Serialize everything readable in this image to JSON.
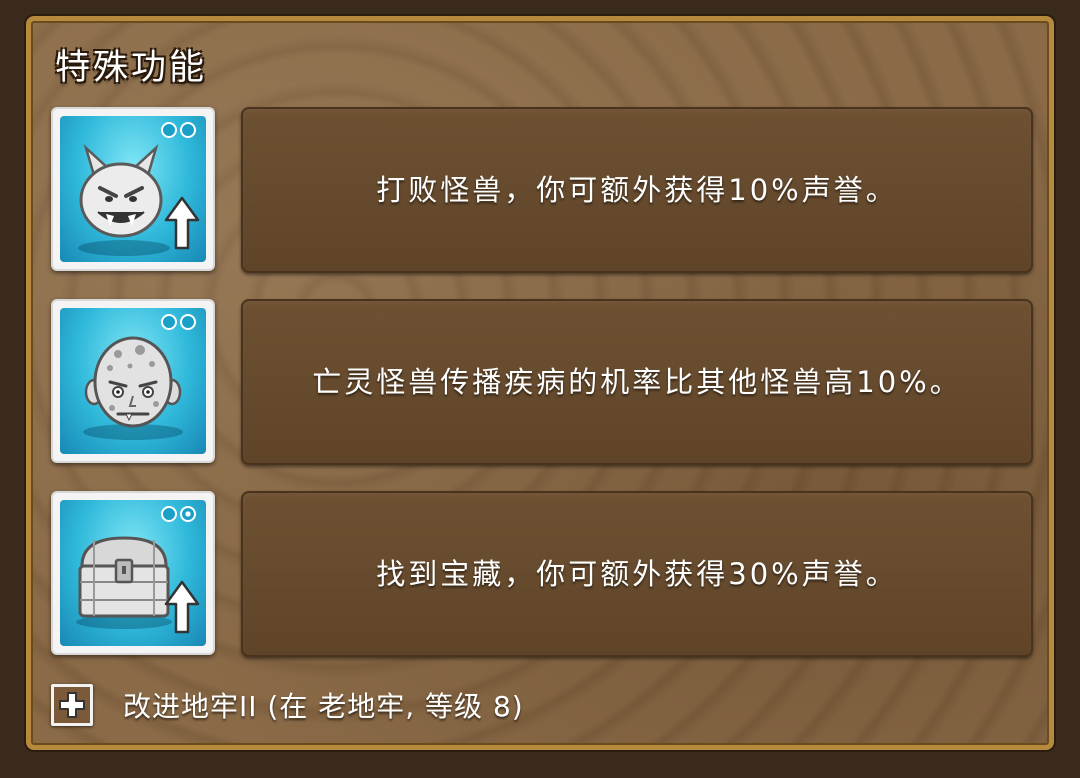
{
  "panel": {
    "title": "特殊功能"
  },
  "features": [
    {
      "icon": "devil-face-up-arrow-icon",
      "description": "打败怪兽，你可额外获得10%声誉。",
      "level_dots_filled": 0,
      "level_dots_total": 2
    },
    {
      "icon": "zombie-head-icon",
      "description": "亡灵怪兽传播疾病的机率比其他怪兽高10%。",
      "level_dots_filled": 0,
      "level_dots_total": 2
    },
    {
      "icon": "treasure-chest-up-arrow-icon",
      "description": "找到宝藏，你可额外获得30%声誉。",
      "level_dots_filled": 1,
      "level_dots_total": 2
    }
  ],
  "footer": {
    "icon": "plus-icon",
    "text": "改进地牢II (在 老地牢, 等级 8)"
  },
  "colors": {
    "frame_border": "#b58a3c",
    "panel_bg": "#85643f",
    "desc_bg": "#6e5133",
    "icon_bg": "#2fb8da"
  }
}
